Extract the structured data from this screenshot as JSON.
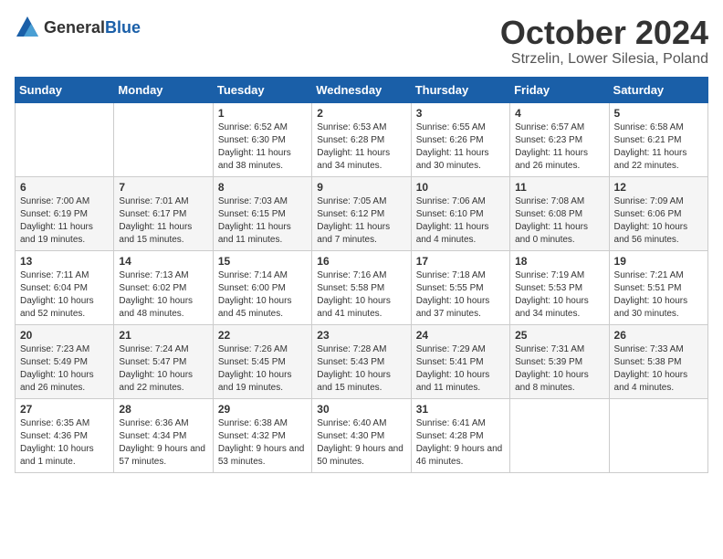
{
  "header": {
    "logo_general": "General",
    "logo_blue": "Blue",
    "month_title": "October 2024",
    "location": "Strzelin, Lower Silesia, Poland"
  },
  "weekdays": [
    "Sunday",
    "Monday",
    "Tuesday",
    "Wednesday",
    "Thursday",
    "Friday",
    "Saturday"
  ],
  "weeks": [
    [
      {
        "day": "",
        "sunrise": "",
        "sunset": "",
        "daylight": ""
      },
      {
        "day": "",
        "sunrise": "",
        "sunset": "",
        "daylight": ""
      },
      {
        "day": "1",
        "sunrise": "Sunrise: 6:52 AM",
        "sunset": "Sunset: 6:30 PM",
        "daylight": "Daylight: 11 hours and 38 minutes."
      },
      {
        "day": "2",
        "sunrise": "Sunrise: 6:53 AM",
        "sunset": "Sunset: 6:28 PM",
        "daylight": "Daylight: 11 hours and 34 minutes."
      },
      {
        "day": "3",
        "sunrise": "Sunrise: 6:55 AM",
        "sunset": "Sunset: 6:26 PM",
        "daylight": "Daylight: 11 hours and 30 minutes."
      },
      {
        "day": "4",
        "sunrise": "Sunrise: 6:57 AM",
        "sunset": "Sunset: 6:23 PM",
        "daylight": "Daylight: 11 hours and 26 minutes."
      },
      {
        "day": "5",
        "sunrise": "Sunrise: 6:58 AM",
        "sunset": "Sunset: 6:21 PM",
        "daylight": "Daylight: 11 hours and 22 minutes."
      }
    ],
    [
      {
        "day": "6",
        "sunrise": "Sunrise: 7:00 AM",
        "sunset": "Sunset: 6:19 PM",
        "daylight": "Daylight: 11 hours and 19 minutes."
      },
      {
        "day": "7",
        "sunrise": "Sunrise: 7:01 AM",
        "sunset": "Sunset: 6:17 PM",
        "daylight": "Daylight: 11 hours and 15 minutes."
      },
      {
        "day": "8",
        "sunrise": "Sunrise: 7:03 AM",
        "sunset": "Sunset: 6:15 PM",
        "daylight": "Daylight: 11 hours and 11 minutes."
      },
      {
        "day": "9",
        "sunrise": "Sunrise: 7:05 AM",
        "sunset": "Sunset: 6:12 PM",
        "daylight": "Daylight: 11 hours and 7 minutes."
      },
      {
        "day": "10",
        "sunrise": "Sunrise: 7:06 AM",
        "sunset": "Sunset: 6:10 PM",
        "daylight": "Daylight: 11 hours and 4 minutes."
      },
      {
        "day": "11",
        "sunrise": "Sunrise: 7:08 AM",
        "sunset": "Sunset: 6:08 PM",
        "daylight": "Daylight: 11 hours and 0 minutes."
      },
      {
        "day": "12",
        "sunrise": "Sunrise: 7:09 AM",
        "sunset": "Sunset: 6:06 PM",
        "daylight": "Daylight: 10 hours and 56 minutes."
      }
    ],
    [
      {
        "day": "13",
        "sunrise": "Sunrise: 7:11 AM",
        "sunset": "Sunset: 6:04 PM",
        "daylight": "Daylight: 10 hours and 52 minutes."
      },
      {
        "day": "14",
        "sunrise": "Sunrise: 7:13 AM",
        "sunset": "Sunset: 6:02 PM",
        "daylight": "Daylight: 10 hours and 48 minutes."
      },
      {
        "day": "15",
        "sunrise": "Sunrise: 7:14 AM",
        "sunset": "Sunset: 6:00 PM",
        "daylight": "Daylight: 10 hours and 45 minutes."
      },
      {
        "day": "16",
        "sunrise": "Sunrise: 7:16 AM",
        "sunset": "Sunset: 5:58 PM",
        "daylight": "Daylight: 10 hours and 41 minutes."
      },
      {
        "day": "17",
        "sunrise": "Sunrise: 7:18 AM",
        "sunset": "Sunset: 5:55 PM",
        "daylight": "Daylight: 10 hours and 37 minutes."
      },
      {
        "day": "18",
        "sunrise": "Sunrise: 7:19 AM",
        "sunset": "Sunset: 5:53 PM",
        "daylight": "Daylight: 10 hours and 34 minutes."
      },
      {
        "day": "19",
        "sunrise": "Sunrise: 7:21 AM",
        "sunset": "Sunset: 5:51 PM",
        "daylight": "Daylight: 10 hours and 30 minutes."
      }
    ],
    [
      {
        "day": "20",
        "sunrise": "Sunrise: 7:23 AM",
        "sunset": "Sunset: 5:49 PM",
        "daylight": "Daylight: 10 hours and 26 minutes."
      },
      {
        "day": "21",
        "sunrise": "Sunrise: 7:24 AM",
        "sunset": "Sunset: 5:47 PM",
        "daylight": "Daylight: 10 hours and 22 minutes."
      },
      {
        "day": "22",
        "sunrise": "Sunrise: 7:26 AM",
        "sunset": "Sunset: 5:45 PM",
        "daylight": "Daylight: 10 hours and 19 minutes."
      },
      {
        "day": "23",
        "sunrise": "Sunrise: 7:28 AM",
        "sunset": "Sunset: 5:43 PM",
        "daylight": "Daylight: 10 hours and 15 minutes."
      },
      {
        "day": "24",
        "sunrise": "Sunrise: 7:29 AM",
        "sunset": "Sunset: 5:41 PM",
        "daylight": "Daylight: 10 hours and 11 minutes."
      },
      {
        "day": "25",
        "sunrise": "Sunrise: 7:31 AM",
        "sunset": "Sunset: 5:39 PM",
        "daylight": "Daylight: 10 hours and 8 minutes."
      },
      {
        "day": "26",
        "sunrise": "Sunrise: 7:33 AM",
        "sunset": "Sunset: 5:38 PM",
        "daylight": "Daylight: 10 hours and 4 minutes."
      }
    ],
    [
      {
        "day": "27",
        "sunrise": "Sunrise: 6:35 AM",
        "sunset": "Sunset: 4:36 PM",
        "daylight": "Daylight: 10 hours and 1 minute."
      },
      {
        "day": "28",
        "sunrise": "Sunrise: 6:36 AM",
        "sunset": "Sunset: 4:34 PM",
        "daylight": "Daylight: 9 hours and 57 minutes."
      },
      {
        "day": "29",
        "sunrise": "Sunrise: 6:38 AM",
        "sunset": "Sunset: 4:32 PM",
        "daylight": "Daylight: 9 hours and 53 minutes."
      },
      {
        "day": "30",
        "sunrise": "Sunrise: 6:40 AM",
        "sunset": "Sunset: 4:30 PM",
        "daylight": "Daylight: 9 hours and 50 minutes."
      },
      {
        "day": "31",
        "sunrise": "Sunrise: 6:41 AM",
        "sunset": "Sunset: 4:28 PM",
        "daylight": "Daylight: 9 hours and 46 minutes."
      },
      {
        "day": "",
        "sunrise": "",
        "sunset": "",
        "daylight": ""
      },
      {
        "day": "",
        "sunrise": "",
        "sunset": "",
        "daylight": ""
      }
    ]
  ]
}
